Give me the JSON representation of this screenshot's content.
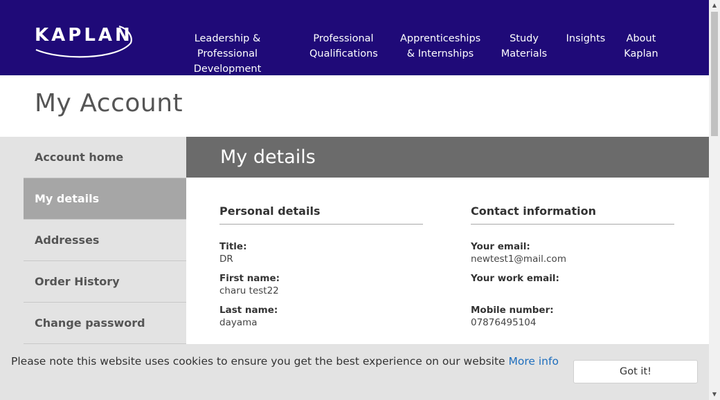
{
  "brand": {
    "name": "KAPLAN"
  },
  "nav": [
    {
      "lines": [
        "Leadership & Professional",
        "Development"
      ]
    },
    {
      "lines": [
        "Professional",
        "Qualifications"
      ]
    },
    {
      "lines": [
        "Apprenticeships",
        "& Internships"
      ]
    },
    {
      "lines": [
        "Study",
        "Materials"
      ]
    },
    {
      "lines": [
        "Insights"
      ]
    },
    {
      "lines": [
        "About",
        "Kaplan"
      ]
    }
  ],
  "page": {
    "title": "My Account"
  },
  "sidebar": {
    "items": [
      {
        "label": "Account home",
        "active": false
      },
      {
        "label": "My details",
        "active": true
      },
      {
        "label": "Addresses",
        "active": false
      },
      {
        "label": "Order History",
        "active": false
      },
      {
        "label": "Change password",
        "active": false
      }
    ]
  },
  "details": {
    "banner": "My details",
    "personal": {
      "heading": "Personal details",
      "title_label": "Title:",
      "title_value": "DR",
      "first_label": "First name:",
      "first_value": "charu test22",
      "last_label": "Last name:",
      "last_value": "dayama"
    },
    "contact": {
      "heading": "Contact information",
      "email_label": "Your email:",
      "email_value": "newtest1@mail.com",
      "work_label": "Your work email:",
      "work_value": "",
      "mobile_label": "Mobile number:",
      "mobile_value": "07876495104"
    }
  },
  "cookie": {
    "message": "Please note this website uses cookies to ensure you get the best experience on our website",
    "link": "More info",
    "button": "Got it!"
  },
  "colors": {
    "header": "#1f0a78",
    "banner": "#6b6b6b",
    "sidebar": "#e3e3e3",
    "active": "#a6a6a6",
    "link": "#1e6ebd"
  }
}
